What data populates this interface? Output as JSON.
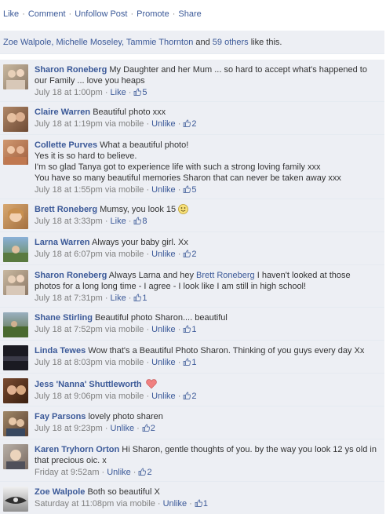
{
  "actions": {
    "like": "Like",
    "comment": "Comment",
    "unfollow": "Unfollow Post",
    "promote": "Promote",
    "share": "Share"
  },
  "likes_summary": {
    "names": "Zoe Walpole, Michelle Moseley, Tammie Thornton",
    "conjunction": " and ",
    "others": "59 others",
    "suffix": " like this."
  },
  "comments": [
    {
      "author": "Sharon Roneberg",
      "text": "My Daughter and her Mum ... so hard to accept what's happened to our Family ... love you heaps",
      "time": "July 18 at 1:00pm",
      "via": "",
      "action": "Like",
      "likes": "5"
    },
    {
      "author": "Claire Warren",
      "text": "Beautiful photo xxx",
      "time": "July 18 at 1:19pm",
      "via": "via mobile",
      "action": "Unlike",
      "likes": "2"
    },
    {
      "author": "Collette Purves",
      "text": "What a beautiful photo!",
      "text2": "Yes it is so hard to believe.",
      "text3": "I'm so glad Tanya got to experience life with such a strong loving family xxx",
      "text4": "You have so many beautiful memories Sharon that can never be taken away xxx",
      "time": "July 18 at 1:55pm",
      "via": "via mobile",
      "action": "Unlike",
      "likes": "5"
    },
    {
      "author": "Brett Roneberg",
      "text": "Mumsy, you look 15",
      "time": "July 18 at 3:33pm",
      "via": "",
      "action": "Like",
      "likes": "8"
    },
    {
      "author": "Larna Warren",
      "text": "Always your baby girl. Xx",
      "time": "July 18 at 6:07pm",
      "via": "via mobile",
      "action": "Unlike",
      "likes": "2"
    },
    {
      "author": "Sharon Roneberg",
      "text_pre": "Always Larna and hey ",
      "mention": "Brett Roneberg",
      "text_post": " I haven't looked at those photos for a long long time - I agree - I look like I am still in high school!",
      "time": "July 18 at 7:31pm",
      "via": "",
      "action": "Like",
      "likes": "1"
    },
    {
      "author": "Shane Stirling",
      "text": "Beautiful photo Sharon.... beautiful",
      "time": "July 18 at 7:52pm",
      "via": "via mobile",
      "action": "Unlike",
      "likes": "1"
    },
    {
      "author": "Linda Tewes",
      "text": "Wow that's a Beautiful Photo Sharon. Thinking of you guys every day Xx",
      "time": "July 18 at 8:03pm",
      "via": "via mobile",
      "action": "Unlike",
      "likes": "1"
    },
    {
      "author": "Jess 'Nanna' Shuttleworth",
      "text": "",
      "time": "July 18 at 9:06pm",
      "via": "via mobile",
      "action": "Unlike",
      "likes": "2"
    },
    {
      "author": "Fay Parsons",
      "text": "lovely photo sharen",
      "time": "July 18 at 9:23pm",
      "via": "",
      "action": "Unlike",
      "likes": "2"
    },
    {
      "author": "Karen Tryhorn Orton",
      "text": "Hi Sharon, gentle thoughts of you. by the way you look 12 ys old in that precious oic. x",
      "time": "Friday at 9:52am",
      "via": "",
      "action": "Unlike",
      "likes": "2"
    },
    {
      "author": "Zoe Walpole",
      "text": "Both so beautiful X",
      "time": "Saturday at 11:08pm",
      "via": "via mobile",
      "action": "Unlike",
      "likes": "1"
    }
  ]
}
